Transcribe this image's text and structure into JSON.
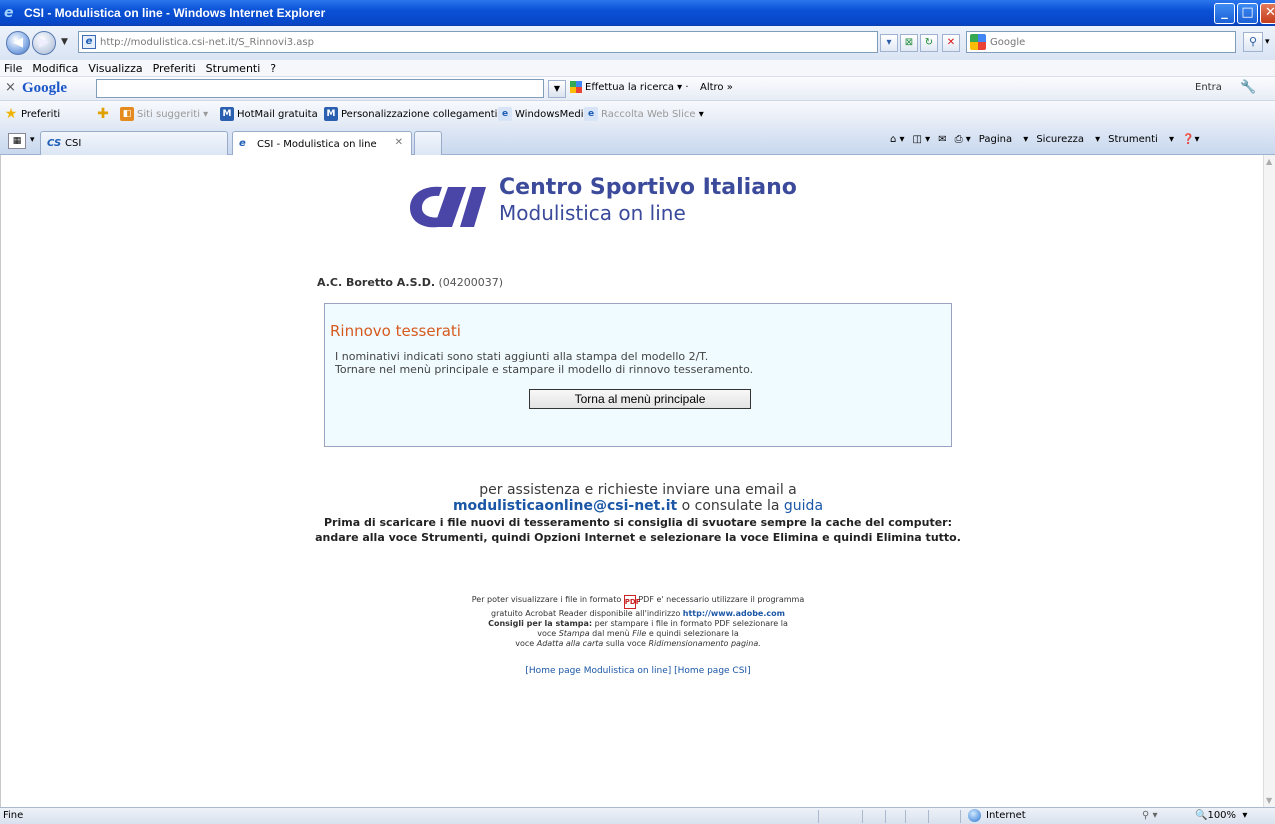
{
  "window": {
    "title": "CSI - Modulistica on line - Windows Internet Explorer"
  },
  "addressbar": {
    "url": "http://modulistica.csi-net.it/S_Rinnovi3.asp",
    "search_placeholder": "Google"
  },
  "menu": {
    "items": [
      "File",
      "Modifica",
      "Visualizza",
      "Preferiti",
      "Strumenti",
      "?"
    ]
  },
  "googlebar": {
    "logo": "Google",
    "search_label": "Effettua la ricerca",
    "more_label": "Altro »",
    "signin_label": "Entra"
  },
  "favorites": {
    "label": "Preferiti",
    "items": [
      "Siti suggeriti",
      "HotMail gratuita",
      "Personalizzazione collegamenti",
      "WindowsMedia",
      "Raccolta Web Slice"
    ]
  },
  "tabs": {
    "items": [
      {
        "label": "CSI"
      },
      {
        "label": "CSI - Modulistica on line"
      }
    ]
  },
  "commandbar": {
    "page": "Pagina",
    "safety": "Sicurezza",
    "tools": "Strumenti"
  },
  "page": {
    "logo_title": "Centro Sportivo Italiano",
    "logo_subtitle": "Modulistica on line",
    "society_name": "A.C. Boretto A.S.D.",
    "society_code": "(04200037)",
    "panel": {
      "title": "Rinnovo tesserati",
      "line1": "I nominativi indicati sono stati aggiunti alla stampa del modello 2/T.",
      "line2": "Tornare nel menù principale e stampare il modello di rinnovo tesseramento.",
      "button": "Torna al menù principale"
    },
    "assist": {
      "line1": "per assistenza e richieste inviare una email a",
      "email": "modulisticaonline@csi-net.it",
      "or": " o consulate la ",
      "guida": "guida",
      "note": "Prima di scaricare i file nuovi di tesseramento si consiglia di svuotare sempre la cache del computer: andare alla voce Strumenti, quindi Opzioni Internet e selezionare la voce Elimina e quindi Elimina tutto."
    },
    "pdf": {
      "p1a": "Per poter visualizzare i file in formato",
      "p1b": "PDF e' necessario utilizzare il programma",
      "p2": "gratuito Acrobat Reader disponibile all'indirizzo",
      "adobe_url": "http://www.adobe.com",
      "tips_label": "Consigli per la stampa:",
      "p3": "per stampare i file in formato PDF selezionare la",
      "p4a": "voce",
      "p4b": "Stampa",
      "p4c": "dal menù",
      "p4d": "File",
      "p4e": "e quindi selezionare la",
      "p5a": "voce",
      "p5b": "Adatta alla carta",
      "p5c": "sulla voce",
      "p5d": "Ridimensionamento pagina."
    },
    "home_links": {
      "modulistica": "[Home page Modulistica on line]",
      "csi": "[Home page CSI]"
    }
  },
  "statusbar": {
    "status": "Fine",
    "zone": "Internet",
    "zoom": "100%"
  },
  "colors": {
    "logo_blue": "#3b4a9a",
    "panel_title": "#d65a1e",
    "panel_bg": "#f0fbff",
    "link": "#1b57a6"
  }
}
